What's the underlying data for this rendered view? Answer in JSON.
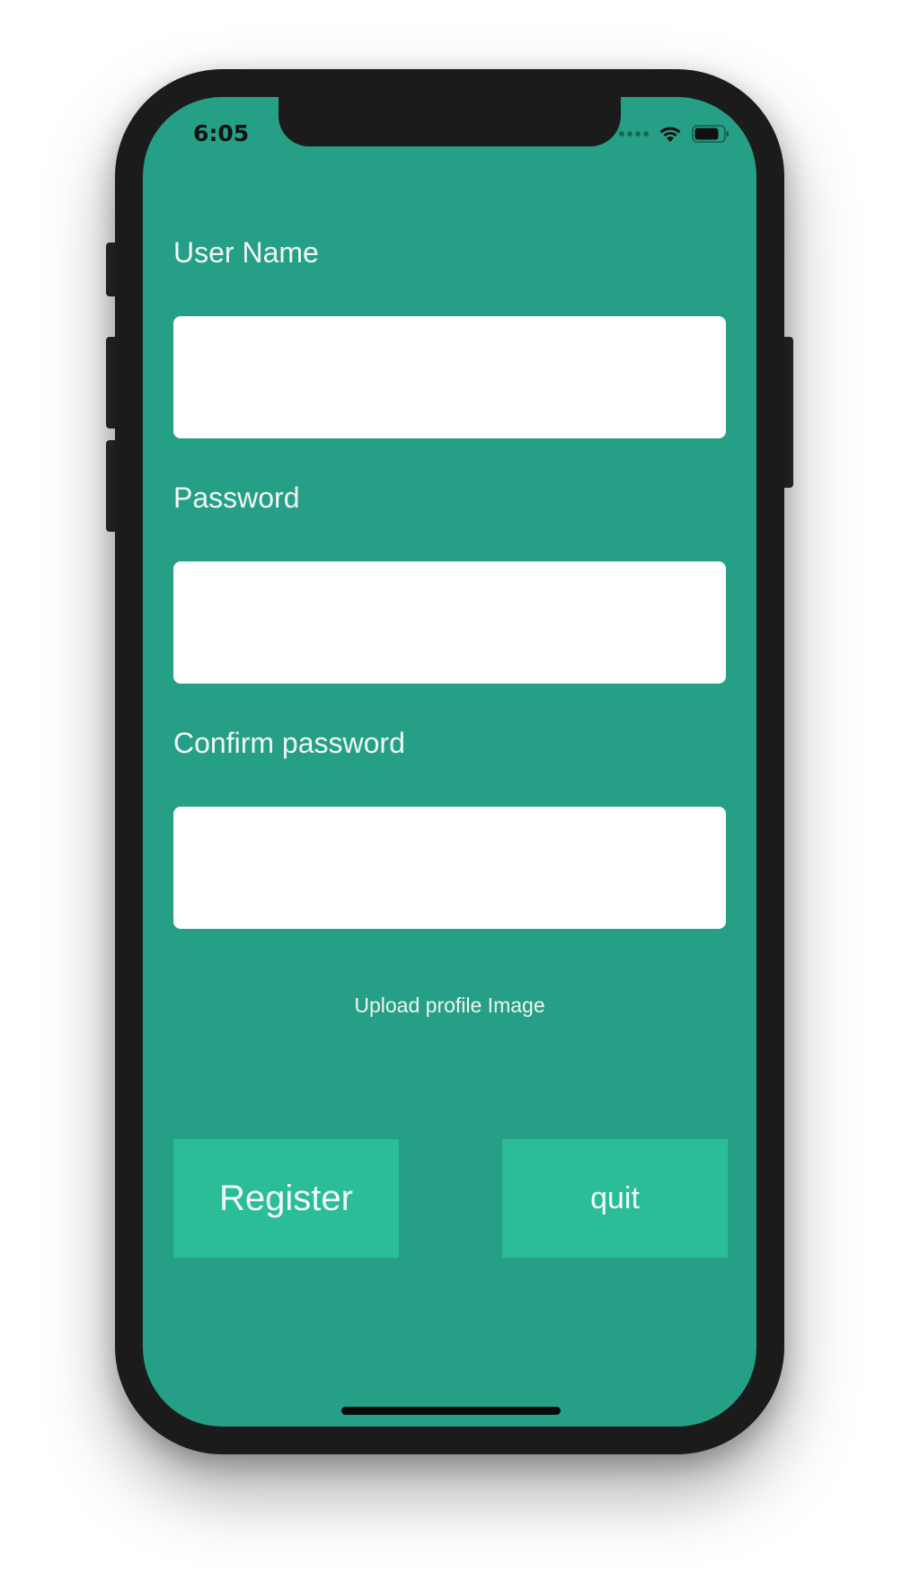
{
  "status_bar": {
    "time": "6:05"
  },
  "form": {
    "username": {
      "label": "User Name",
      "value": "",
      "placeholder": ""
    },
    "password": {
      "label": "Password",
      "value": "",
      "placeholder": ""
    },
    "confirm_password": {
      "label": "Confirm password",
      "value": "",
      "placeholder": ""
    },
    "upload_label": "Upload profile Image"
  },
  "actions": {
    "register_label": "Register",
    "quit_label": "quit"
  },
  "colors": {
    "background": "#25a086",
    "button": "#2abd98",
    "text": "#f2f6f4"
  },
  "icons": [
    "signal-icon",
    "wifi-icon",
    "battery-icon"
  ]
}
